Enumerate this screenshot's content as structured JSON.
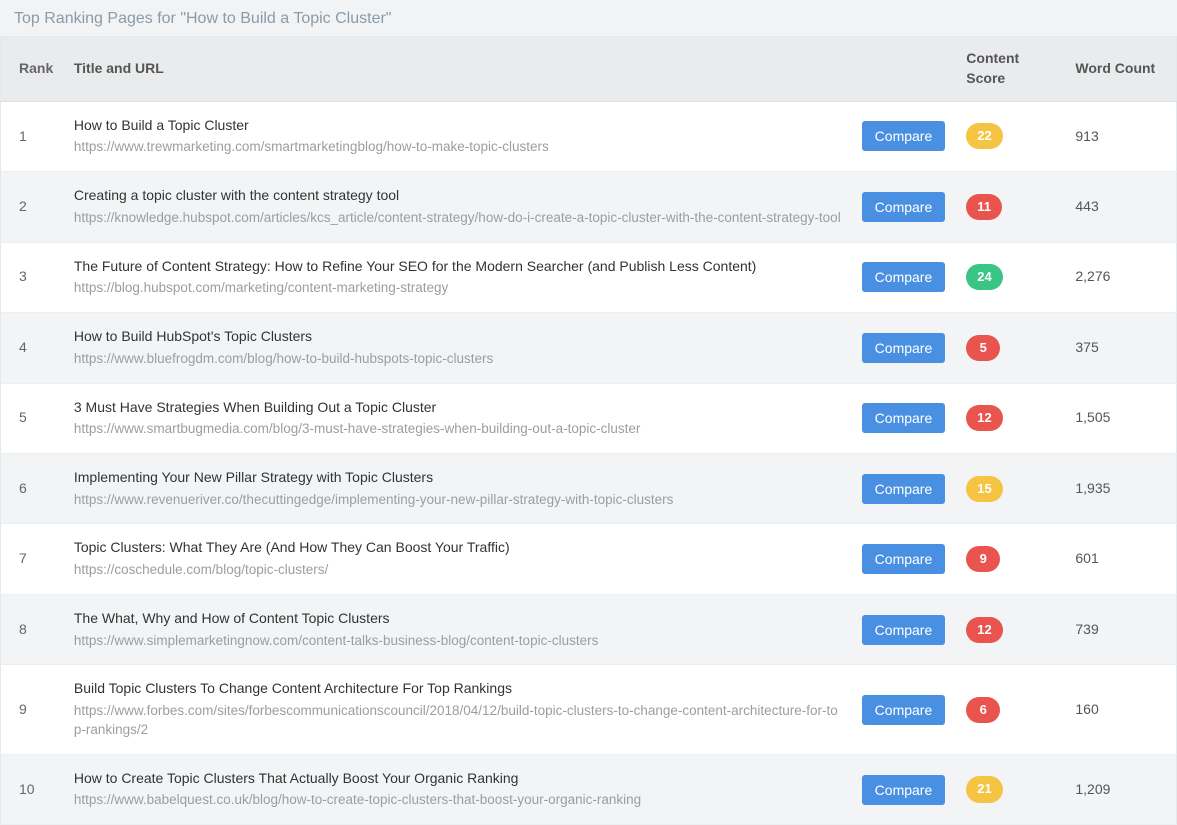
{
  "page_title": "Top Ranking Pages for \"How to Build a Topic Cluster\"",
  "columns": {
    "rank": "Rank",
    "title_url": "Title and URL",
    "compare": "",
    "content_score": "Content Score",
    "word_count": "Word Count"
  },
  "compare_label": "Compare",
  "rows": [
    {
      "rank": "1",
      "title": "How to Build a Topic Cluster",
      "url": "https://www.trewmarketing.com/smartmarketingblog/how-to-make-topic-clusters",
      "score": "22",
      "score_color": "yellow",
      "word_count": "913"
    },
    {
      "rank": "2",
      "title": "Creating a topic cluster with the content strategy tool",
      "url": "https://knowledge.hubspot.com/articles/kcs_article/content-strategy/how-do-i-create-a-topic-cluster-with-the-content-strategy-tool",
      "score": "11",
      "score_color": "red",
      "word_count": "443"
    },
    {
      "rank": "3",
      "title": "The Future of Content Strategy: How to Refine Your SEO for the Modern Searcher (and Publish Less Content)",
      "url": "https://blog.hubspot.com/marketing/content-marketing-strategy",
      "score": "24",
      "score_color": "green",
      "word_count": "2,276"
    },
    {
      "rank": "4",
      "title": "How to Build HubSpot's Topic Clusters",
      "url": "https://www.bluefrogdm.com/blog/how-to-build-hubspots-topic-clusters",
      "score": "5",
      "score_color": "red",
      "word_count": "375"
    },
    {
      "rank": "5",
      "title": "3 Must Have Strategies When Building Out a Topic Cluster",
      "url": "https://www.smartbugmedia.com/blog/3-must-have-strategies-when-building-out-a-topic-cluster",
      "score": "12",
      "score_color": "red",
      "word_count": "1,505"
    },
    {
      "rank": "6",
      "title": "Implementing Your New Pillar Strategy with Topic Clusters",
      "url": "https://www.revenueriver.co/thecuttingedge/implementing-your-new-pillar-strategy-with-topic-clusters",
      "score": "15",
      "score_color": "yellow",
      "word_count": "1,935"
    },
    {
      "rank": "7",
      "title": "Topic Clusters: What They Are (And How They Can Boost Your Traffic)",
      "url": "https://coschedule.com/blog/topic-clusters/",
      "score": "9",
      "score_color": "red",
      "word_count": "601"
    },
    {
      "rank": "8",
      "title": "The What, Why and How of Content Topic Clusters",
      "url": "https://www.simplemarketingnow.com/content-talks-business-blog/content-topic-clusters",
      "score": "12",
      "score_color": "red",
      "word_count": "739"
    },
    {
      "rank": "9",
      "title": "Build Topic Clusters To Change Content Architecture For Top Rankings",
      "url": "https://www.forbes.com/sites/forbescommunicationscouncil/2018/04/12/build-topic-clusters-to-change-content-architecture-for-top-rankings/2",
      "score": "6",
      "score_color": "red",
      "word_count": "160"
    },
    {
      "rank": "10",
      "title": "How to Create Topic Clusters That Actually Boost Your Organic Ranking",
      "url": "https://www.babelquest.co.uk/blog/how-to-create-topic-clusters-that-boost-your-organic-ranking",
      "score": "21",
      "score_color": "yellow",
      "word_count": "1,209"
    }
  ]
}
